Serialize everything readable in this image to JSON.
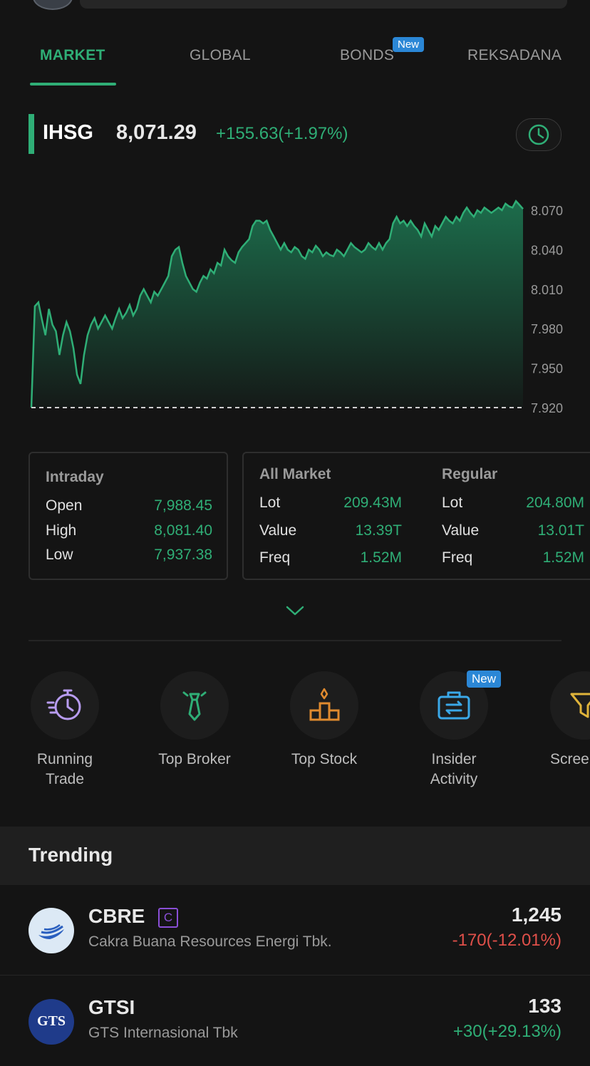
{
  "tabs": [
    {
      "label": "MARKET",
      "active": true
    },
    {
      "label": "GLOBAL",
      "active": false
    },
    {
      "label": "BONDS",
      "active": false,
      "badge": "New"
    },
    {
      "label": "REKSADANA",
      "active": false
    }
  ],
  "index": {
    "name": "IHSG",
    "value": "8,071.29",
    "change": "+155.63(+1.97%)"
  },
  "chart_data": {
    "type": "area",
    "yticks": [
      "8.070",
      "8.040",
      "8.010",
      "7.980",
      "7.950",
      "7.920"
    ],
    "ylim": [
      7920,
      8070
    ],
    "baseline": 7920,
    "series": [
      {
        "values": [
          7920,
          7997,
          8000,
          7987,
          7975,
          7995,
          7983,
          7978,
          7960,
          7975,
          7985,
          7978,
          7965,
          7945,
          7938,
          7960,
          7975,
          7983,
          7988,
          7980,
          7985,
          7990,
          7985,
          7980,
          7988,
          7995,
          7988,
          7992,
          7998,
          7990,
          7995,
          8005,
          8010,
          8005,
          8000,
          8008,
          8005,
          8010,
          8015,
          8020,
          8035,
          8040,
          8042,
          8030,
          8020,
          8015,
          8010,
          8008,
          8015,
          8020,
          8018,
          8025,
          8022,
          8030,
          8028,
          8040,
          8035,
          8032,
          8030,
          8038,
          8042,
          8045,
          8048,
          8058,
          8062,
          8062,
          8060,
          8062,
          8055,
          8050,
          8045,
          8040,
          8045,
          8040,
          8038,
          8042,
          8040,
          8035,
          8033,
          8040,
          8038,
          8043,
          8040,
          8035,
          8038,
          8036,
          8035,
          8040,
          8038,
          8035,
          8040,
          8045,
          8042,
          8040,
          8038,
          8040,
          8045,
          8042,
          8040,
          8045,
          8040,
          8045,
          8048,
          8060,
          8065,
          8060,
          8062,
          8058,
          8062,
          8058,
          8055,
          8050,
          8060,
          8055,
          8050,
          8058,
          8055,
          8060,
          8065,
          8062,
          8060,
          8065,
          8062,
          8068,
          8072,
          8068,
          8065,
          8070,
          8068,
          8072,
          8070,
          8068,
          8070,
          8072,
          8070,
          8075,
          8073,
          8072,
          8077,
          8074,
          8071
        ]
      }
    ],
    "color": "#2fae76"
  },
  "intraday": {
    "title": "Intraday",
    "rows": [
      {
        "label": "Open",
        "value": "7,988.45"
      },
      {
        "label": "High",
        "value": "8,081.40"
      },
      {
        "label": "Low",
        "value": "7,937.38"
      }
    ]
  },
  "all_market": {
    "title": "All Market",
    "rows": [
      {
        "label": "Lot",
        "value": "209.43M"
      },
      {
        "label": "Value",
        "value": "13.39T"
      },
      {
        "label": "Freq",
        "value": "1.52M"
      }
    ]
  },
  "regular": {
    "title": "Regular",
    "rows": [
      {
        "label": "Lot",
        "value": "204.80M"
      },
      {
        "label": "Value",
        "value": "13.01T"
      },
      {
        "label": "Freq",
        "value": "1.52M"
      }
    ]
  },
  "menu": [
    {
      "label": "Running Trade",
      "icon": "running-trade-icon"
    },
    {
      "label": "Top Broker",
      "icon": "tie-icon"
    },
    {
      "label": "Top Stock",
      "icon": "podium-icon"
    },
    {
      "label": "Insider Activity",
      "icon": "briefcase-icon",
      "badge": "New"
    },
    {
      "label": "Scree",
      "icon": "filter-icon"
    }
  ],
  "trending": {
    "title": "Trending",
    "items": [
      {
        "ticker": "CBRE",
        "badge": "C",
        "name": "Cakra Buana Resources Energi Tbk.",
        "price": "1,245",
        "change": "-170(-12.01%)",
        "direction": "down"
      },
      {
        "ticker": "GTSI",
        "name": "GTS Internasional Tbk",
        "logo_text": "GTS",
        "price": "133",
        "change": "+30(+29.13%)",
        "direction": "up"
      }
    ]
  },
  "colors": {
    "up": "#2fae76",
    "down": "#e0504a",
    "accent": "#2fae76",
    "badge": "#2b87d6"
  }
}
